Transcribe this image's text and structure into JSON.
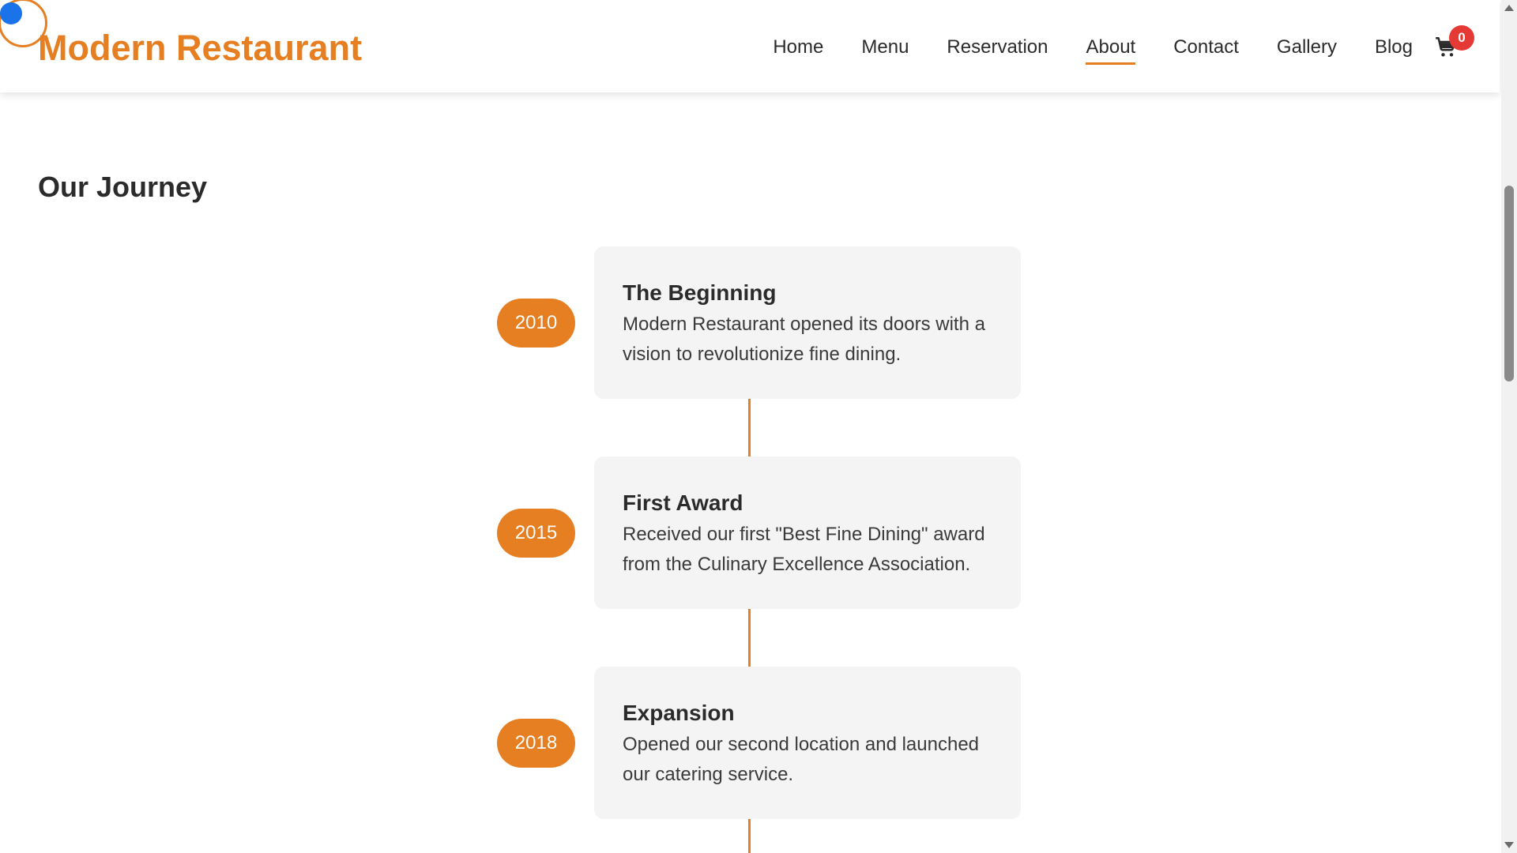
{
  "header": {
    "logo": "Modern Restaurant",
    "nav": [
      {
        "label": "Home",
        "active": false
      },
      {
        "label": "Menu",
        "active": false
      },
      {
        "label": "Reservation",
        "active": false
      },
      {
        "label": "About",
        "active": true
      },
      {
        "label": "Contact",
        "active": false
      },
      {
        "label": "Gallery",
        "active": false
      },
      {
        "label": "Blog",
        "active": false
      }
    ],
    "cart": {
      "icon": "cart-icon",
      "count": "0"
    }
  },
  "section": {
    "title": "Our Journey"
  },
  "timeline": [
    {
      "year": "2010",
      "title": "The Beginning",
      "description": "Modern Restaurant opened its doors with a vision to revolutionize fine dining."
    },
    {
      "year": "2015",
      "title": "First Award",
      "description": "Received our first \"Best Fine Dining\" award from the Culinary Excellence Association."
    },
    {
      "year": "2018",
      "title": "Expansion",
      "description": "Opened our second location and launched our catering service."
    }
  ],
  "colors": {
    "accent": "#e67e22",
    "badge": "#e53935",
    "card_bg": "#f4f4f4",
    "text": "#2b2b2b"
  }
}
